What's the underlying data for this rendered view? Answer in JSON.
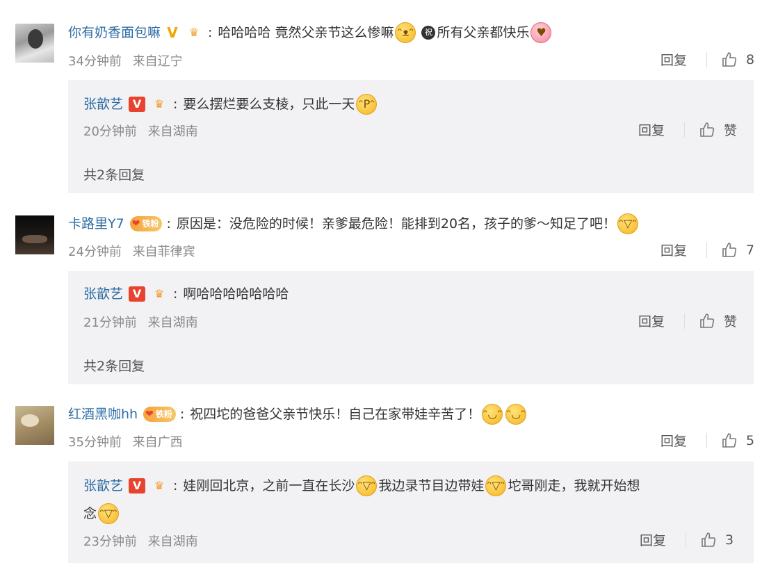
{
  "comments": [
    {
      "username": "你有奶香面包嘛",
      "text_a": "哈哈哈哈 竟然父亲节这么惨嘛",
      "text_b": "所有父亲都快乐",
      "circle_badge": "祝",
      "time": "34分钟前",
      "location": "来自辽宁",
      "reply_label": "回复",
      "likes": "8",
      "reply": {
        "username": "张歆艺",
        "vip": "V",
        "text": "要么摆烂要么支棱，只此一天",
        "time": "20分钟前",
        "location": "来自湖南",
        "reply_label": "回复",
        "likes": "赞"
      },
      "more": "共2条回复"
    },
    {
      "username": "卡路里Y7",
      "fan_badge": "铁粉",
      "text": "原因是：没危险的时候！亲爹最危险！能排到20名，孩子的爹～知足了吧！",
      "time": "24分钟前",
      "location": "来自菲律宾",
      "reply_label": "回复",
      "likes": "7",
      "reply": {
        "username": "张歆艺",
        "vip": "V",
        "text": "啊哈哈哈哈哈哈哈",
        "time": "21分钟前",
        "location": "来自湖南",
        "reply_label": "回复",
        "likes": "赞"
      },
      "more": "共2条回复"
    },
    {
      "username": "红酒黑咖hh",
      "fan_badge": "铁粉",
      "text": "祝四坨的爸爸父亲节快乐！自己在家带娃辛苦了！",
      "time": "35分钟前",
      "location": "来自广西",
      "reply_label": "回复",
      "likes": "5",
      "reply": {
        "username": "张歆艺",
        "vip": "V",
        "text_a": "娃刚回北京，之前一直在长沙",
        "text_b": "我边录节目边带娃",
        "text_c": "坨哥刚走，我就开始想",
        "text_d": "念",
        "time": "23分钟前",
        "location": "来自湖南",
        "reply_label": "回复",
        "likes": "3"
      }
    }
  ],
  "icons": {
    "like": "thumbs-up-icon",
    "laugh": "laughing-face-icon",
    "tongue": "tongue-out-face-icon",
    "cry_laugh": "tears-of-joy-icon"
  },
  "colors": {
    "username": "#2e6da4",
    "vip_box": "#e8432f",
    "v_verified": "#f0a500",
    "reply_bg": "#f2f2f5"
  }
}
